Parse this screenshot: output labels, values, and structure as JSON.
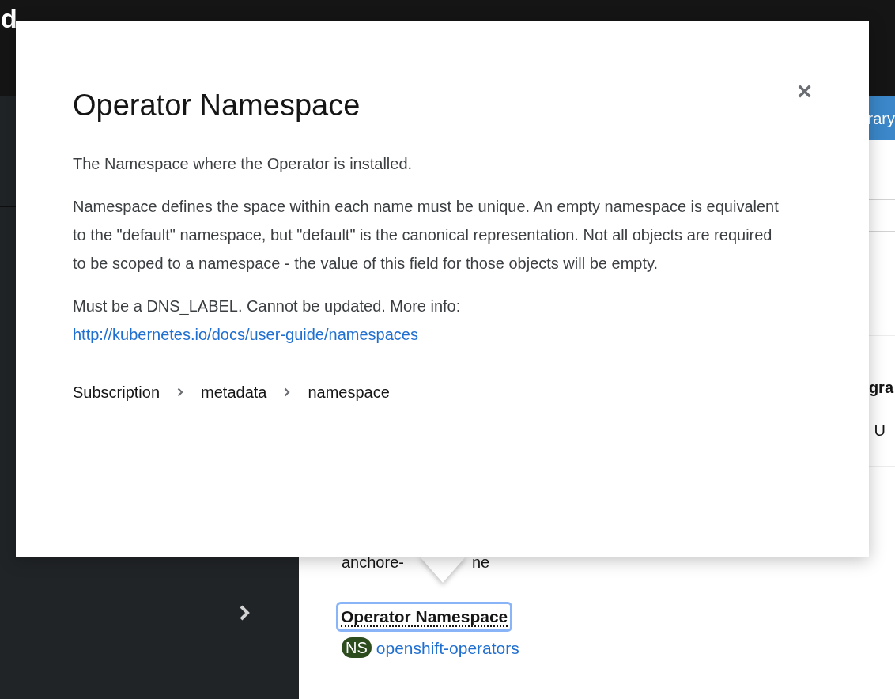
{
  "masthead": {
    "logo_fragment": "d"
  },
  "popover": {
    "title": "Operator Namespace",
    "close": "×",
    "paragraphs": [
      "The Namespace where the Operator is installed.",
      "Namespace defines the space within each name must be unique. An empty namespace is equivalent to the \"default\" namespace, but \"default\" is the canonical representation. Not all objects are required to be scoped to a namespace - the value of this field for those objects will be empty.",
      "Must be a DNS_LABEL. Cannot be updated. More info:"
    ],
    "link": "http://kubernetes.io/docs/user-guide/namespaces",
    "breadcrumb": [
      "Subscription",
      "metadata",
      "namespace"
    ]
  },
  "content": {
    "button_fragment": "rary",
    "heading_fragment": "gra",
    "status_fragment": "U",
    "name_fragments": [
      "anchore-",
      "ne"
    ],
    "field_label": {
      "text": "Operator Namespace",
      "focused": true
    },
    "namespace_badge": "NS",
    "namespace_link": "openshift-operators"
  }
}
